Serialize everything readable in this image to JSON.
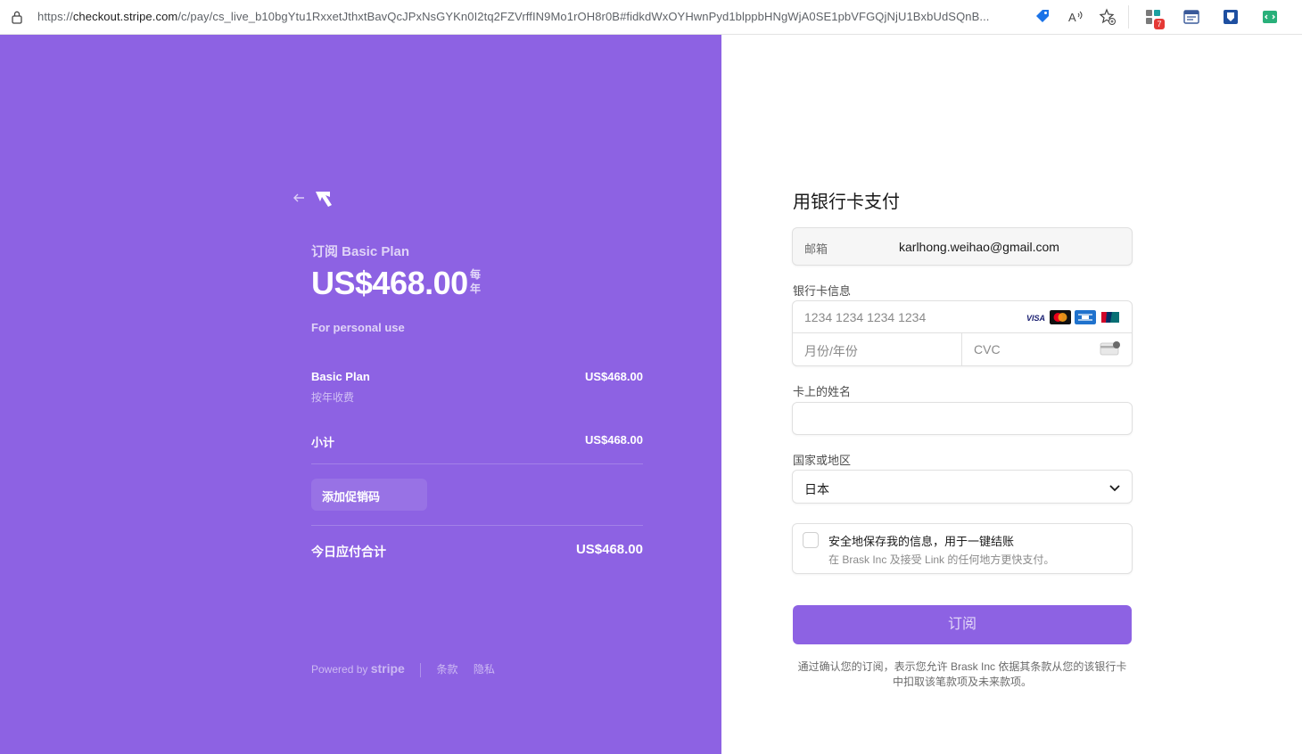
{
  "browser": {
    "url_prefix": "https://",
    "url_host": "checkout.stripe.com",
    "url_rest": "/c/pay/cs_live_b10bgYtu1RxxetJthxtBavQcJPxNsGYKn0I2tq2FZVrffIN9Mo1rOH8r0B#fidkdWxOYHwnPyd1blppbHNgWjA0SE1pbVFGQjNjU1BxbUdSQnB...",
    "extension_badge": "7"
  },
  "summary": {
    "product_label": "订阅 Basic Plan",
    "price": "US$468.00",
    "period": "每年",
    "description": "For personal use",
    "items": [
      {
        "name": "Basic Plan",
        "sub": "按年收费",
        "amount": "US$468.00"
      }
    ],
    "subtotal_label": "小计",
    "subtotal_value": "US$468.00",
    "promo_label": "添加促销码",
    "total_label": "今日应付合计",
    "total_value": "US$468.00",
    "footer": {
      "powered_by": "Powered by",
      "stripe": "stripe",
      "terms": "条款",
      "privacy": "隐私"
    }
  },
  "form": {
    "title": "用银行卡支付",
    "email_label": "邮箱",
    "email_value": "karlhong.weihao@gmail.com",
    "card_label": "银行卡信息",
    "card_number_placeholder": "1234 1234 1234 1234",
    "expiry_placeholder": "月份/年份",
    "cvc_placeholder": "CVC",
    "name_label": "卡上的姓名",
    "country_label": "国家或地区",
    "country_value": "日本",
    "save_title": "安全地保存我的信息，用于一键结账",
    "save_sub": "在 Brask Inc 及接受 Link 的任何地方更快支付。",
    "subscribe_label": "订阅",
    "legal": "通过确认您的订阅，表示您允许 Brask Inc 依据其条款从您的该银行卡中扣取该笔款项及未来款项。"
  },
  "colors": {
    "accent": "#8d62e3",
    "white": "#ffffff"
  }
}
